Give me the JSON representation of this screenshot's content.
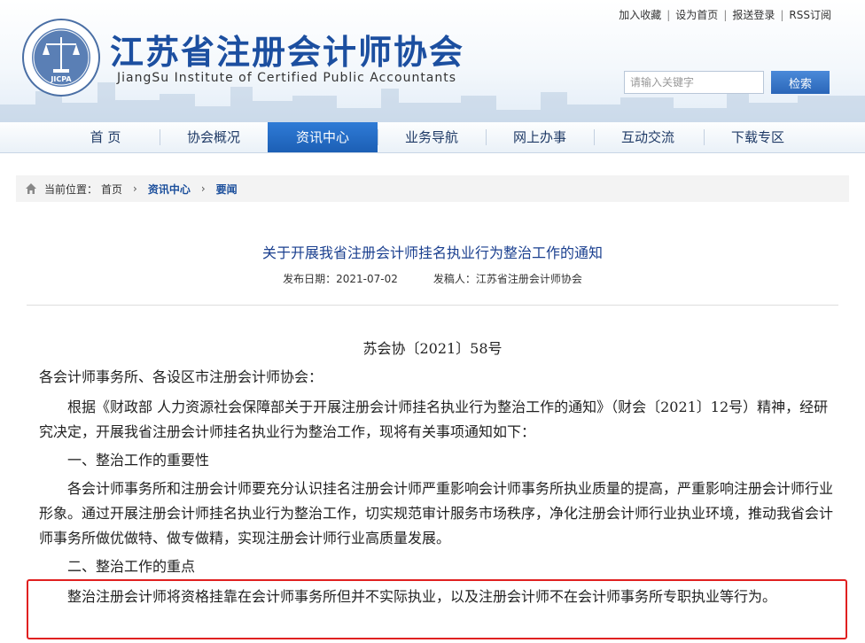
{
  "header": {
    "top_links": [
      "加入收藏",
      "设为首页",
      "报送登录",
      "RSS订阅"
    ],
    "site_title": "江苏省注册会计师协会",
    "site_subtitle": "JiangSu Institute of Certified Public Accountants",
    "logo_text": "JICPA",
    "search_placeholder": "请输入关键字",
    "search_button": "检索"
  },
  "nav": {
    "items": [
      "首 页",
      "协会概况",
      "资讯中心",
      "业务导航",
      "网上办事",
      "互动交流",
      "下载专区"
    ],
    "active_index": 2
  },
  "breadcrumb": {
    "label": "当前位置：",
    "items": [
      "首页",
      "资讯中心",
      "要闻"
    ]
  },
  "article": {
    "title": "关于开展我省注册会计师挂名执业行为整治工作的通知",
    "publish_date_label": "发布日期：2021-07-02",
    "author_label": "发稿人：江苏省注册会计师协会",
    "doc_number": "苏会协〔2021〕58号",
    "greeting": "各会计师事务所、各设区市注册会计师协会：",
    "para1": "根据《财政部 人力资源社会保障部关于开展注册会计师挂名执业行为整治工作的通知》（财会〔2021〕12号）精神，经研究决定，开展我省注册会计师挂名执业行为整治工作，现将有关事项通知如下：",
    "heading1": "一、整治工作的重要性",
    "para2": "各会计师事务所和注册会计师要充分认识挂名注册会计师严重影响会计师事务所执业质量的提高，严重影响注册会计师行业形象。通过开展注册会计师挂名执业行为整治工作，切实规范审计服务市场秩序，净化注册会计师行业执业环境，推动我省会计师事务所做优做特、做专做精，实现注册会计师行业高质量发展。",
    "heading2": "二、整治工作的重点",
    "para3": "整治注册会计师将资格挂靠在会计师事务所但并不实际执业，以及注册会计师不在会计师事务所专职执业等行为。"
  },
  "colors": {
    "brand": "#1c4fa0",
    "nav_active": "#2f7bd6",
    "highlight": "#e02020"
  }
}
